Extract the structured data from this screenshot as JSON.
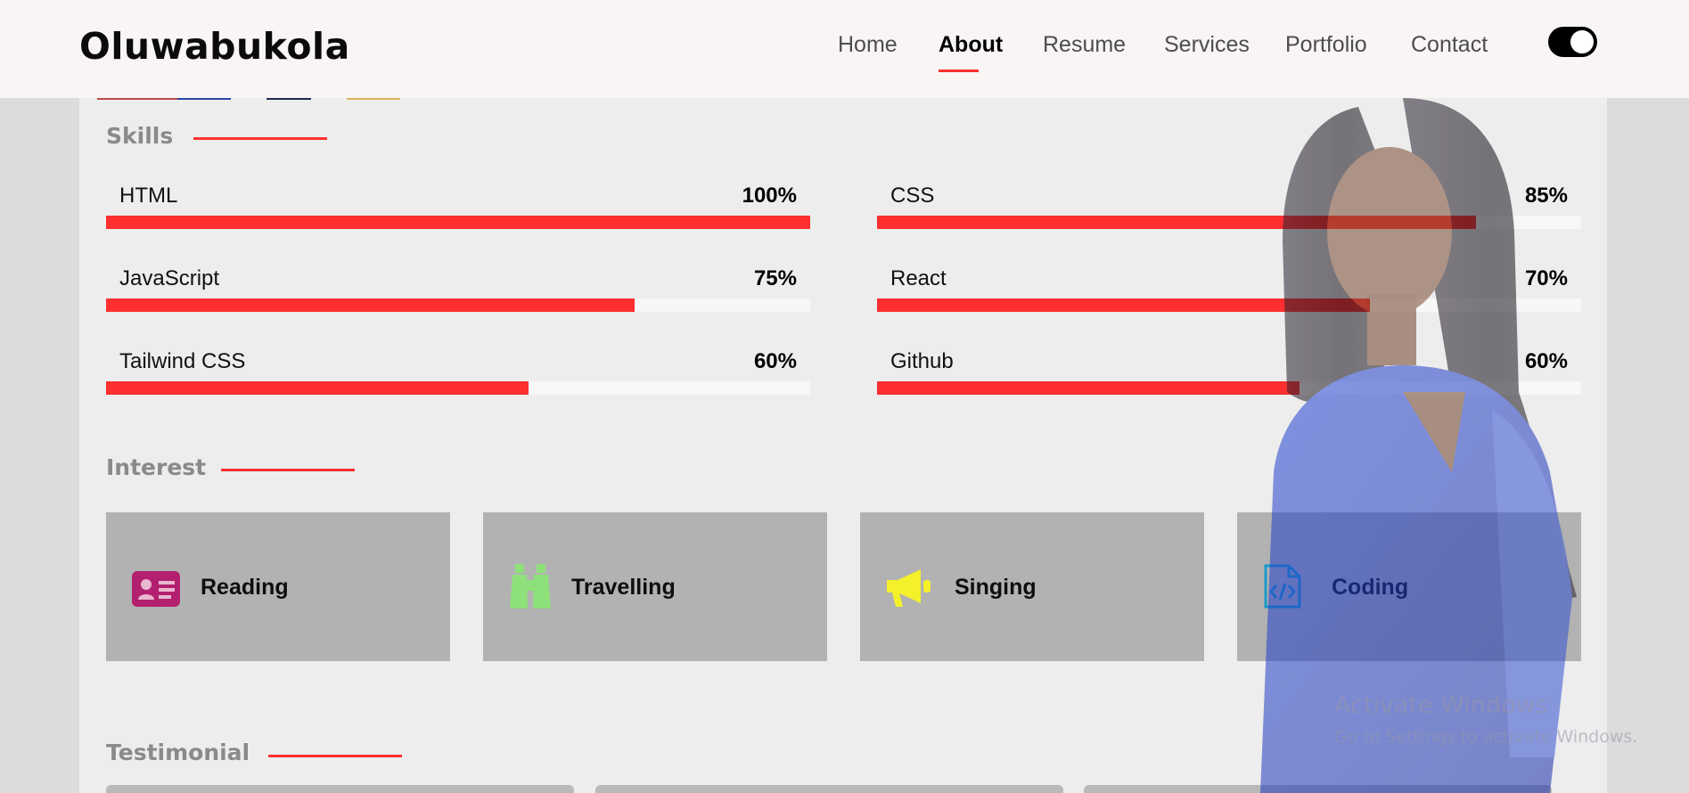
{
  "brand": "Oluwabukola",
  "nav": {
    "items": [
      "Home",
      "About",
      "Resume",
      "Services",
      "Portfolio",
      "Contact"
    ],
    "active": "About"
  },
  "theme_toggle": {
    "state": "on"
  },
  "skills": {
    "title": "Skills",
    "items": [
      {
        "label": "HTML",
        "percent_text": "100%",
        "percent": 100
      },
      {
        "label": "CSS",
        "percent_text": "85%",
        "percent": 85
      },
      {
        "label": "JavaScript",
        "percent_text": "75%",
        "percent": 75
      },
      {
        "label": "React",
        "percent_text": "70%",
        "percent": 70
      },
      {
        "label": "Tailwind CSS",
        "percent_text": "60%",
        "percent": 60
      },
      {
        "label": "Github",
        "percent_text": "60%",
        "percent": 60
      }
    ]
  },
  "interest": {
    "title": "Interest",
    "items": [
      {
        "label": "Reading",
        "icon": "id-card-icon",
        "color": "#b3206f"
      },
      {
        "label": "Travelling",
        "icon": "binoculars-icon",
        "color": "#8ee07a"
      },
      {
        "label": "Singing",
        "icon": "megaphone-icon",
        "color": "#f4f02a"
      },
      {
        "label": "Coding",
        "icon": "code-file-icon",
        "color": "#1b9ac9"
      }
    ]
  },
  "testimonial": {
    "title": "Testimonial"
  },
  "watermark": {
    "line1": "Activate Windows",
    "line2": "Go to Settings to activate Windows."
  },
  "colors": {
    "accent": "#ff2f2f",
    "header_bg": "#f8f5f4",
    "card_bg": "#b2b2b2"
  }
}
